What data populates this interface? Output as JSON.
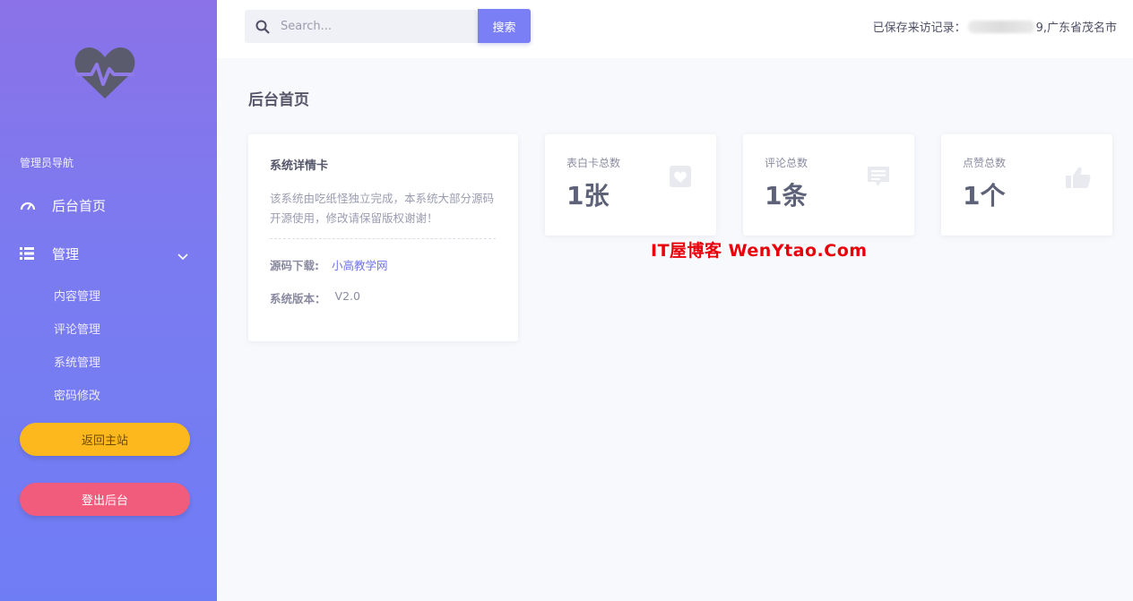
{
  "sidebar": {
    "section_title": "管理员导航",
    "nav": {
      "home_label": "后台首页",
      "manage_label": "管理"
    },
    "sub_items": [
      "内容管理",
      "评论管理",
      "系统管理",
      "密码修改"
    ],
    "back_button": "返回主站",
    "logout_button": "登出后台"
  },
  "topbar": {
    "search_placeholder": "Search...",
    "search_button": "搜索",
    "visit_prefix": "已保存来访记录：",
    "visit_suffix": "9,广东省茂名市"
  },
  "main": {
    "page_title": "后台首页",
    "detail_card": {
      "title": "系统详情卡",
      "description": "该系统由吃纸怪独立完成，本系统大部分源码开源使用，修改请保留版权谢谢！",
      "source_label": "源码下载:",
      "source_value": "小高教学网",
      "version_label": "系统版本：",
      "version_value": "V2.0"
    },
    "stats": [
      {
        "label": "表白卡总数",
        "value": "1张",
        "icon": "heart-icon"
      },
      {
        "label": "评论总数",
        "value": "1条",
        "icon": "comment-icon"
      },
      {
        "label": "点赞总数",
        "value": "1个",
        "icon": "thumbs-up-icon"
      }
    ]
  },
  "watermark": "IT屋博客  WenYtao.Com",
  "colors": {
    "sidebar_top": "#8b72e8",
    "sidebar_bottom": "#6f7df5",
    "accent": "#7b7ff5",
    "back_button": "#fdb81e",
    "logout_button": "#f25c7c",
    "watermark": "#e8000b"
  }
}
